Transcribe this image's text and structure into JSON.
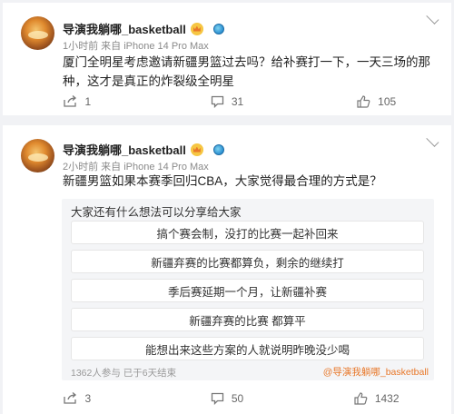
{
  "posts": [
    {
      "author": "导演我躺哪_basketball",
      "meta": "1小时前 来自 iPhone 14 Pro Max",
      "text": "厦门全明星考虑邀请新疆男篮过去吗？给补赛打一下，一天三场的那种，这才是真正的炸裂级全明星",
      "share_count": "1",
      "comment_count": "31",
      "like_count": "105"
    },
    {
      "author": "导演我躺哪_basketball",
      "meta": "2小时前 来自 iPhone 14 Pro Max",
      "text": "新疆男篮如果本赛季回归CBA，大家觉得最合理的方式是？",
      "poll": {
        "title": "大家还有什么想法可以分享给大家",
        "options": [
          "搞个赛会制，没打的比赛一起补回来",
          "新疆弃赛的比赛都算负，剩余的继续打",
          "季后赛延期一个月，让新疆补赛",
          "新疆弃赛的比赛 都算平",
          "能想出来这些方案的人就说明昨晚没少喝"
        ],
        "footer": "1362人参与 已于6天结束",
        "source": "@导演我躺哪_basketball"
      },
      "share_count": "3",
      "comment_count": "50",
      "like_count": "1432"
    }
  ],
  "colors": {
    "accent": "#e8782a",
    "background": "#f1f2f5"
  },
  "icons": [
    "share-icon",
    "comment-icon",
    "like-icon",
    "more-chevron-icon",
    "crown-badge-icon",
    "globe-badge-icon"
  ]
}
